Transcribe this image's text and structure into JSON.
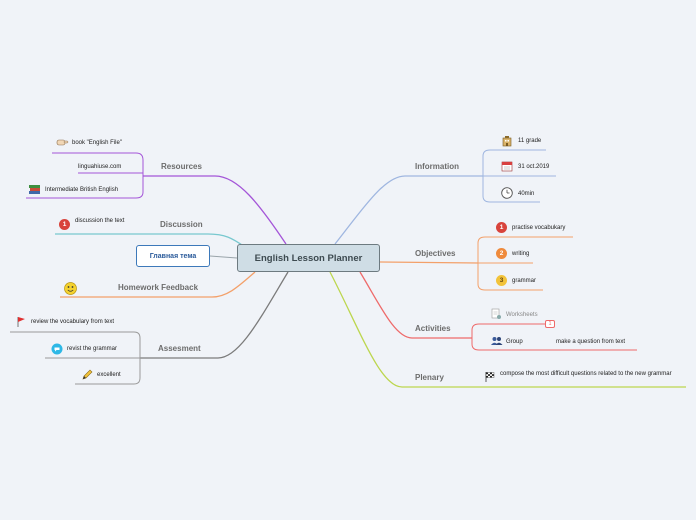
{
  "central": "English Lesson Planner",
  "floating_topic": "Главная тема",
  "branches": {
    "resources": {
      "label": "Resources",
      "items": [
        "book \"English File\"",
        "linguahiuse.com",
        "Intermediate British English"
      ]
    },
    "discussion": {
      "label": "Discussion",
      "items": [
        "discussion  the text"
      ]
    },
    "homework": {
      "label": "Homework Feedback"
    },
    "assesment": {
      "label": "Assesment",
      "items": [
        "review the vocabulary from text",
        "revist the grammar",
        "excellent"
      ]
    },
    "information": {
      "label": "Information",
      "items": [
        "11 grade",
        "31 oct.2019",
        "40min"
      ]
    },
    "objectives": {
      "label": "Objectives",
      "items": [
        "practise vocabukary",
        "writing",
        "grammar"
      ]
    },
    "activities": {
      "label": "Activities",
      "items": [
        "Worksheets",
        "Group"
      ],
      "callout_badge": "1",
      "group_child": "make a question from text"
    },
    "plenary": {
      "label": "Plenary",
      "items": [
        "compose the most difficult questions related to the new grammar"
      ]
    }
  },
  "colors": {
    "resources": "#a455d8",
    "discussion": "#78c8cf",
    "homework": "#f3a06a",
    "assesment": "#7b7b7b",
    "information": "#9fb6e0",
    "objectives": "#f3a06a",
    "activities": "#ee6a6a",
    "plenary": "#bcd64e"
  },
  "icons": {
    "book": "hand-pointer-icon",
    "british": "books-icon",
    "homework": "smiley-icon",
    "flag": "red-flag-icon",
    "revist": "speech-bubble-icon",
    "excellent": "pencil-icon",
    "grade": "building-icon",
    "date": "calendar-icon",
    "time": "clock-icon",
    "worksheets": "document-icon",
    "group": "people-icon",
    "plenary": "checkered-flag-icon"
  }
}
